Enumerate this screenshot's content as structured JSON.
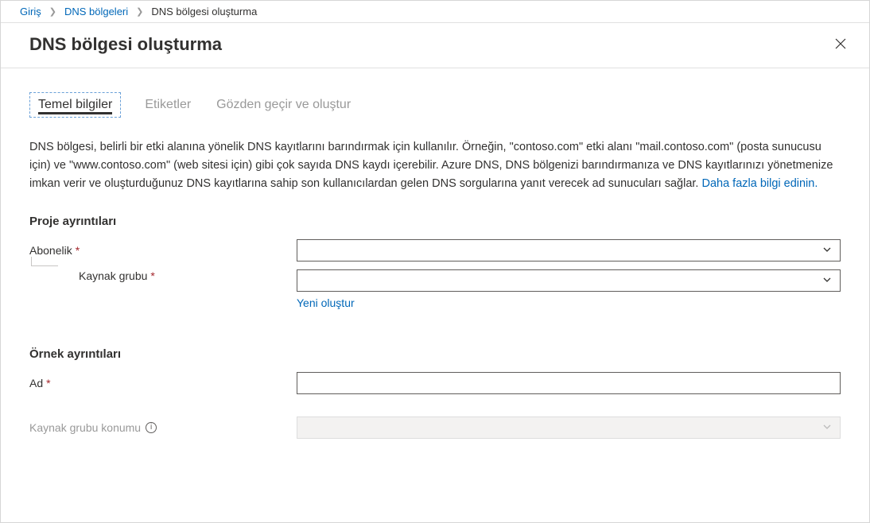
{
  "breadcrumb": {
    "home": "Giriş",
    "zones": "DNS bölgeleri",
    "create": "DNS bölgesi oluşturma"
  },
  "page_title": "DNS bölgesi oluşturma",
  "tabs": {
    "basics": "Temel bilgiler",
    "tags": "Etiketler",
    "review": "Gözden geçir ve oluştur"
  },
  "description": "DNS bölgesi, belirli bir etki alanına yönelik DNS kayıtlarını barındırmak için kullanılır. Örneğin, \"contoso.com\" etki alanı \"mail.contoso.com\" (posta sunucusu için) ve \"www.contoso.com\" (web sitesi için) gibi çok sayıda DNS kaydı içerebilir. Azure DNS, DNS bölgenizi barındırmanıza ve DNS kayıtlarınızı yönetmenize imkan verir ve oluşturduğunuz DNS kayıtlarına sahip son kullanıcılardan gelen DNS sorgularına yanıt verecek ad sunucuları sağlar. ",
  "learn_more": "Daha fazla bilgi edinin.",
  "sections": {
    "project_details": "Proje ayrıntıları",
    "instance_details": "Örnek ayrıntıları"
  },
  "fields": {
    "subscription": {
      "label": "Abonelik",
      "value": ""
    },
    "resource_group": {
      "label": "Kaynak grubu",
      "value": "",
      "create_new": "Yeni oluştur"
    },
    "name": {
      "label": "Ad",
      "value": ""
    },
    "rg_location": {
      "label": "Kaynak grubu konumu",
      "value": ""
    }
  },
  "required_marker": "*"
}
